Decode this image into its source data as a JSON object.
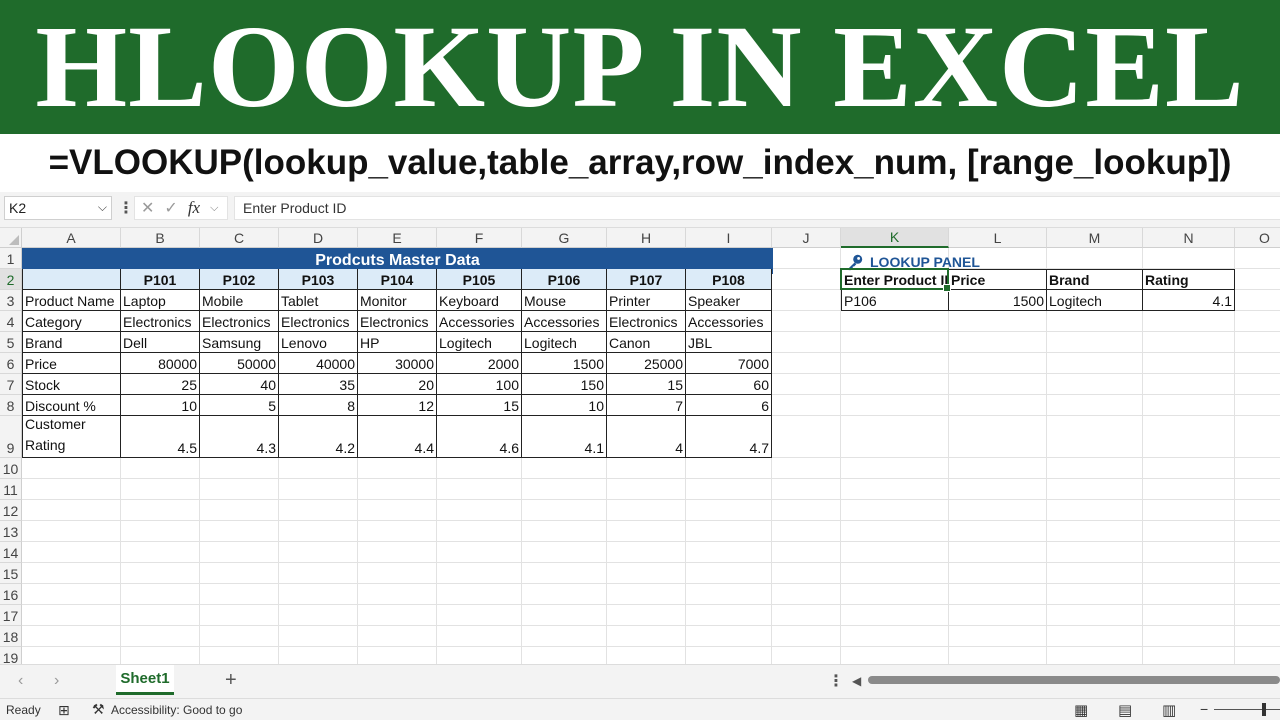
{
  "banner": {
    "title": "HLOOKUP IN EXCEL",
    "syntax": "=VLOOKUP(lookup_value,table_array,row_index_num, [range_lookup])"
  },
  "formula_bar": {
    "name_box": "K2",
    "fx_label": "fx",
    "content": "Enter Product ID"
  },
  "columns": [
    "A",
    "B",
    "C",
    "D",
    "E",
    "F",
    "G",
    "H",
    "I",
    "J",
    "K",
    "L",
    "M",
    "N",
    "O"
  ],
  "rows": [
    "1",
    "2",
    "3",
    "4",
    "5",
    "6",
    "7",
    "8",
    "9",
    "10",
    "11",
    "12",
    "13",
    "14",
    "15",
    "16",
    "17",
    "18",
    "19"
  ],
  "selected_cell": "K2",
  "master_table": {
    "title": "Prodcuts Master Data",
    "product_ids": [
      "P101",
      "P102",
      "P103",
      "P104",
      "P105",
      "P106",
      "P107",
      "P108"
    ],
    "rows": [
      {
        "label": "Product Name",
        "values": [
          "Laptop",
          "Mobile",
          "Tablet",
          "Monitor",
          "Keyboard",
          "Mouse",
          "Printer",
          "Speaker"
        ]
      },
      {
        "label": "Category",
        "values": [
          "Electronics",
          "Electronics",
          "Electronics",
          "Electronics",
          "Accessories",
          "Accessories",
          "Electronics",
          "Accessories"
        ]
      },
      {
        "label": "Brand",
        "values": [
          "Dell",
          "Samsung",
          "Lenovo",
          "HP",
          "Logitech",
          "Logitech",
          "Canon",
          "JBL"
        ]
      },
      {
        "label": "Price",
        "values": [
          "80000",
          "50000",
          "40000",
          "30000",
          "2000",
          "1500",
          "25000",
          "7000"
        ]
      },
      {
        "label": "Stock",
        "values": [
          "25",
          "40",
          "35",
          "20",
          "100",
          "150",
          "15",
          "60"
        ]
      },
      {
        "label": "Discount %",
        "values": [
          "10",
          "5",
          "8",
          "12",
          "15",
          "10",
          "7",
          "6"
        ]
      },
      {
        "label": "Customer Rating",
        "values": [
          "4.5",
          "4.3",
          "4.2",
          "4.4",
          "4.6",
          "4.1",
          "4",
          "4.7"
        ]
      }
    ]
  },
  "lookup_panel": {
    "title": "LOOKUP PANEL",
    "icon": "key-icon",
    "headers": [
      "Enter Product ID",
      "Price",
      "Brand",
      "Rating"
    ],
    "values": [
      "P106",
      "1500",
      "Logitech",
      "4.1"
    ]
  },
  "sheet_tabs": {
    "active": "Sheet1",
    "add_label": "+"
  },
  "status_bar": {
    "ready": "Ready",
    "accessibility": "Accessibility: Good to go"
  },
  "colors": {
    "banner_green": "#1f6b2b",
    "title_blue": "#1f5596",
    "header_fill": "#dcebf8"
  }
}
